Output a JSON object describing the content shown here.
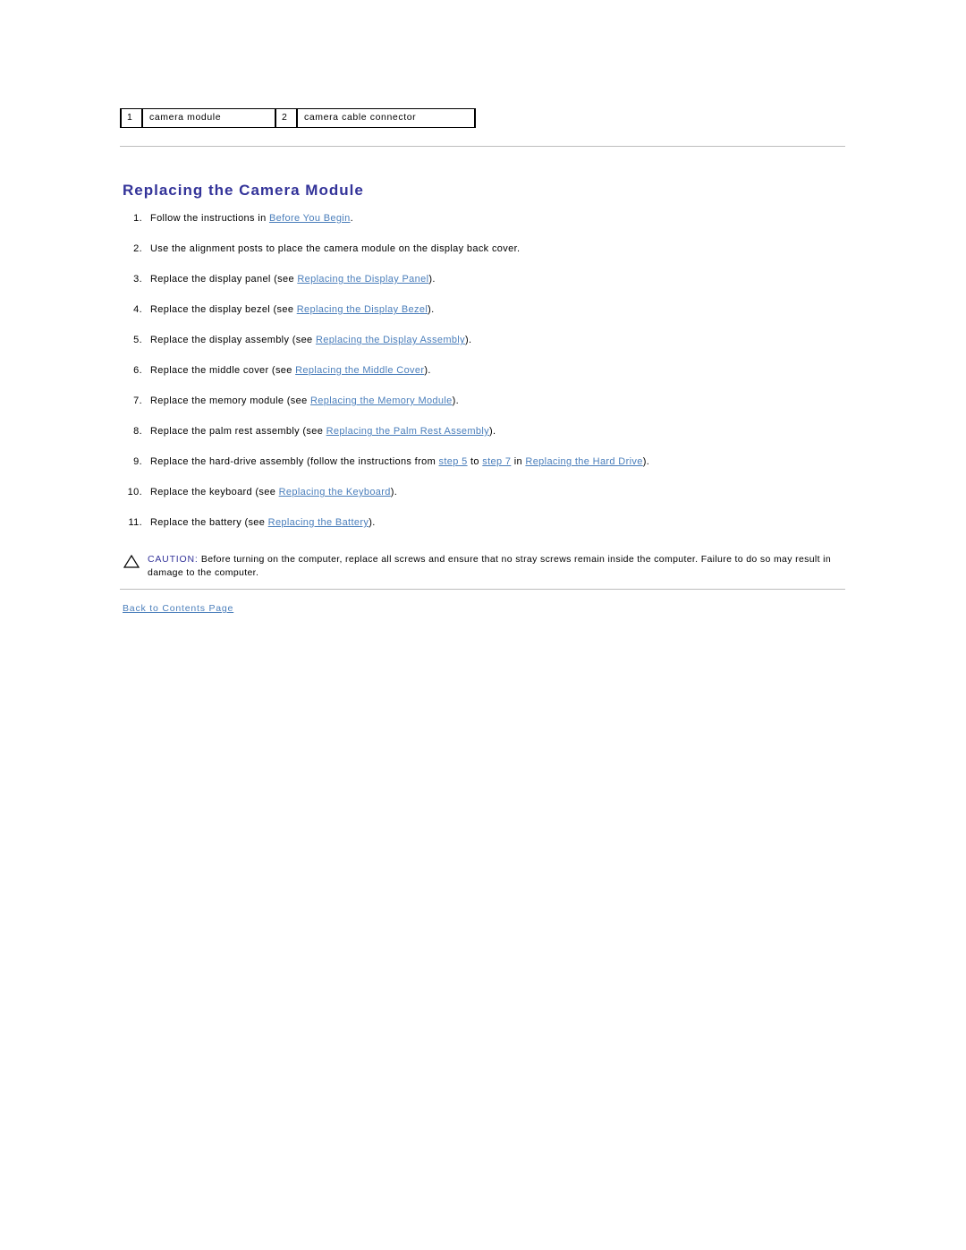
{
  "legend": {
    "callouts": [
      {
        "number": "1",
        "label": "camera module"
      },
      {
        "number": "2",
        "label": "camera cable connector"
      }
    ]
  },
  "heading": {
    "title": "Replacing the Camera Module"
  },
  "colors": {
    "heading": "#333399",
    "link": "#4a7ebb",
    "rule": "#bdbdbd",
    "text": "#000000",
    "page_background": "#ffffff"
  },
  "steps": [
    {
      "number": "1.",
      "parts": [
        {
          "type": "text",
          "value": "Follow the instructions in "
        },
        {
          "type": "link",
          "value": "Before You Begin"
        },
        {
          "type": "text",
          "value": "."
        }
      ]
    },
    {
      "number": "2.",
      "parts": [
        {
          "type": "text",
          "value": "Use the alignment posts to place the camera module on the display back cover."
        }
      ]
    },
    {
      "number": "3.",
      "parts": [
        {
          "type": "text",
          "value": "Replace the display panel (see "
        },
        {
          "type": "link",
          "value": "Replacing the Display Panel"
        },
        {
          "type": "text",
          "value": ")."
        }
      ]
    },
    {
      "number": "4.",
      "parts": [
        {
          "type": "text",
          "value": "Replace the display bezel (see "
        },
        {
          "type": "link",
          "value": "Replacing the Display Bezel"
        },
        {
          "type": "text",
          "value": ")."
        }
      ]
    },
    {
      "number": "5.",
      "parts": [
        {
          "type": "text",
          "value": "Replace the display assembly (see "
        },
        {
          "type": "link",
          "value": "Replacing the Display Assembly"
        },
        {
          "type": "text",
          "value": ")."
        }
      ]
    },
    {
      "number": "6.",
      "parts": [
        {
          "type": "text",
          "value": "Replace the middle cover (see "
        },
        {
          "type": "link",
          "value": "Replacing the Middle Cover"
        },
        {
          "type": "text",
          "value": ")."
        }
      ]
    },
    {
      "number": "7.",
      "parts": [
        {
          "type": "text",
          "value": "Replace the memory module (see "
        },
        {
          "type": "link",
          "value": "Replacing the Memory Module"
        },
        {
          "type": "text",
          "value": ")."
        }
      ]
    },
    {
      "number": "8.",
      "parts": [
        {
          "type": "text",
          "value": "Replace the palm rest assembly (see "
        },
        {
          "type": "link",
          "value": "Replacing the Palm Rest Assembly"
        },
        {
          "type": "text",
          "value": ")."
        }
      ]
    },
    {
      "number": "9.",
      "parts": [
        {
          "type": "text",
          "value": "Replace the hard-drive assembly (follow the instructions from "
        },
        {
          "type": "link",
          "value": "step 5"
        },
        {
          "type": "text",
          "value": " to "
        },
        {
          "type": "link",
          "value": "step 7"
        },
        {
          "type": "text",
          "value": " in "
        },
        {
          "type": "link",
          "value": "Replacing the Hard Drive"
        },
        {
          "type": "text",
          "value": ")."
        }
      ]
    },
    {
      "number": "10.",
      "parts": [
        {
          "type": "text",
          "value": "Replace the keyboard (see "
        },
        {
          "type": "link",
          "value": "Replacing the Keyboard"
        },
        {
          "type": "text",
          "value": ")."
        }
      ]
    },
    {
      "number": "11.",
      "parts": [
        {
          "type": "text",
          "value": "Replace the battery (see "
        },
        {
          "type": "link",
          "value": "Replacing the Battery"
        },
        {
          "type": "text",
          "value": ")."
        }
      ]
    }
  ],
  "caution": {
    "icon": "warning-triangle-icon",
    "keyword": "CAUTION:",
    "body": " Before turning on the computer, replace all screws and ensure that no stray screws remain inside the computer. Failure to do so may result in damage to the computer."
  },
  "footer": {
    "back_link": "Back to Contents Page"
  }
}
